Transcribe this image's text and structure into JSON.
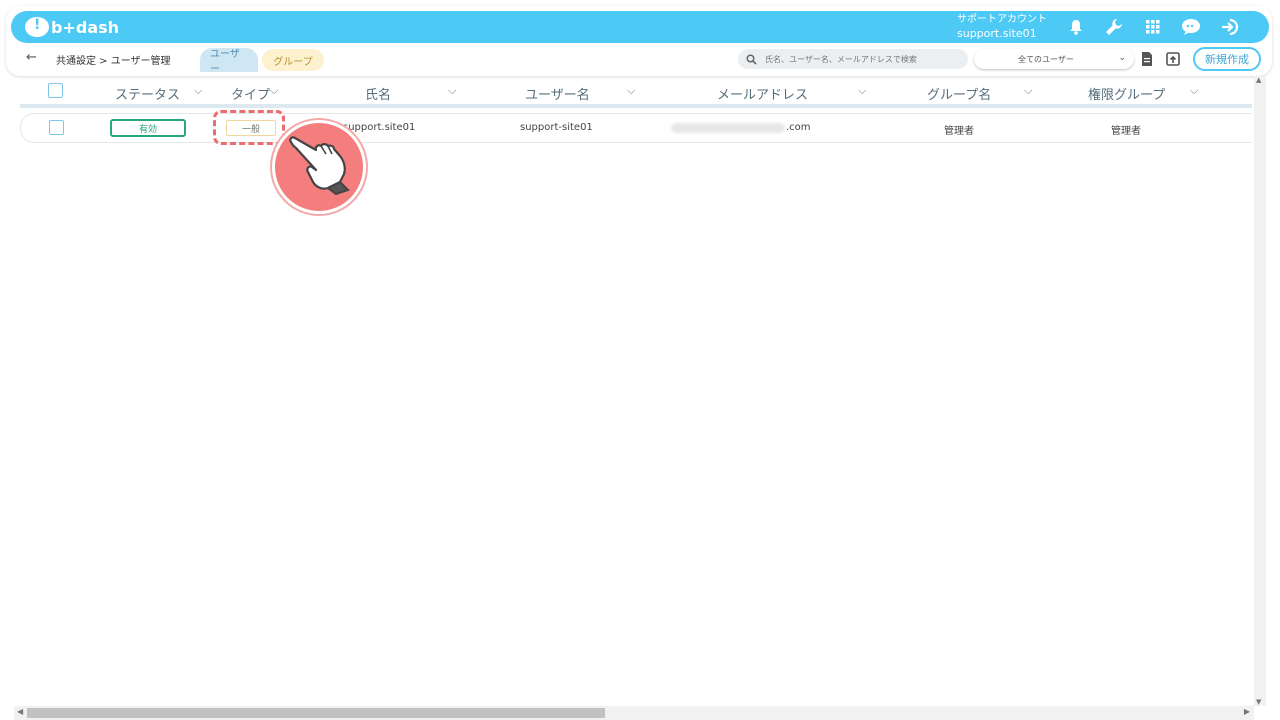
{
  "app": {
    "logo_text": "b+dash",
    "account_label": "サポートアカウント",
    "account_name": "support.site01"
  },
  "topbar_icons": [
    "bell-icon",
    "wrench-icon",
    "grid-icon",
    "chat-icon",
    "logout-icon"
  ],
  "subbar": {
    "back_label": "←",
    "breadcrumb": "共通設定 > ユーザー管理",
    "tabs": [
      {
        "label": "ユーザー",
        "active": true
      },
      {
        "label": "グループ",
        "active": false
      }
    ],
    "search_placeholder": "氏名、ユーザー名、メールアドレスで検索",
    "filter_selected": "全てのユーザー",
    "new_button": "新規作成"
  },
  "table": {
    "columns": [
      "ステータス",
      "タイプ",
      "氏名",
      "ユーザー名",
      "メールアドレス",
      "グループ名",
      "権限グループ"
    ],
    "rows": [
      {
        "status": "有効",
        "type": "一般",
        "full_name": "support.site01",
        "username": "support-site01",
        "email_visible": ".com",
        "group": "管理者",
        "permission_group": "管理者"
      }
    ]
  },
  "colors": {
    "brand": "#4dc9f5",
    "status_active": "#28a77a",
    "highlight": "#ec6d6d"
  }
}
